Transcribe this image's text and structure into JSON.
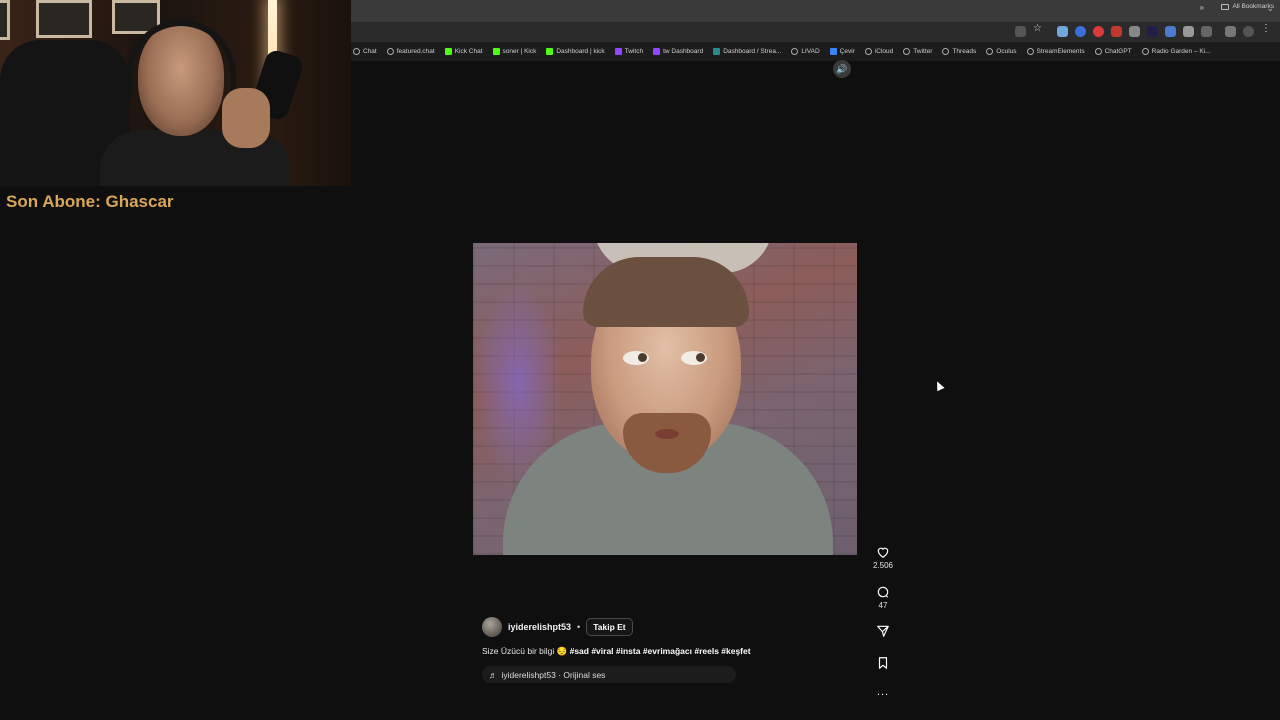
{
  "overlay": {
    "subscriber_label": "Son Abone: Ghascar"
  },
  "browser": {
    "bookmarks": [
      {
        "label": "Chat",
        "icon": "chat-bookmark-icon",
        "kind": ""
      },
      {
        "label": "featured.chat",
        "icon": "globe-icon",
        "kind": ""
      },
      {
        "label": "Kick Chat",
        "icon": "kick-icon",
        "kind": "k"
      },
      {
        "label": "soner | Kick",
        "icon": "kick-icon",
        "kind": "k"
      },
      {
        "label": "Dashboard | kick",
        "icon": "kick-icon",
        "kind": "k"
      },
      {
        "label": "Twitch",
        "icon": "twitch-icon",
        "kind": "t"
      },
      {
        "label": "tw Dashboard",
        "icon": "twitch-icon",
        "kind": "t"
      },
      {
        "label": "Dashboard / Strea...",
        "icon": "tracker-icon",
        "kind": "tr"
      },
      {
        "label": "LIVAD",
        "icon": "globe-icon",
        "kind": ""
      },
      {
        "label": "Çevir",
        "icon": "translate-icon",
        "kind": "c"
      },
      {
        "label": "iCloud",
        "icon": "apple-icon",
        "kind": ""
      },
      {
        "label": "Twitter",
        "icon": "globe-icon",
        "kind": ""
      },
      {
        "label": "Threads",
        "icon": "globe-icon",
        "kind": ""
      },
      {
        "label": "Oculus",
        "icon": "globe-icon",
        "kind": ""
      },
      {
        "label": "StreamElements",
        "icon": "globe-icon",
        "kind": ""
      },
      {
        "label": "ChatGPT",
        "icon": "globe-icon",
        "kind": ""
      },
      {
        "label": "Radio Garden – Ki...",
        "icon": "globe-icon",
        "kind": ""
      }
    ],
    "more_label": "»",
    "all_bookmarks_label": "All Bookmarks"
  },
  "reel": {
    "likes": "2.506",
    "comments": "47",
    "username": "iyiderelishpt53",
    "separator": "•",
    "follow_label": "Takip Et",
    "caption_text": "Size Üzücü bir bilgi 😔 ",
    "caption_tags": "#sad #viral #insta #evrimağacı #reels #keşfet",
    "audio_label": "iyiderelishpt53 · Orijinal ses",
    "more_label": "..."
  }
}
